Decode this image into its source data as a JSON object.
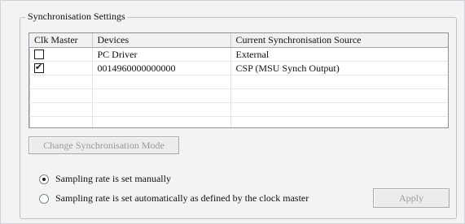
{
  "group": {
    "title": "Synchronisation Settings"
  },
  "table": {
    "columns": [
      "Clk Master",
      "Devices",
      "Current Synchronisation Source"
    ],
    "rows": [
      {
        "checked": false,
        "device": "PC Driver",
        "source": "External"
      },
      {
        "checked": true,
        "device": "0014960000000000",
        "source": "CSP (MSU Synch Output)"
      }
    ]
  },
  "buttons": {
    "change_mode": "Change Synchronisation Mode",
    "apply": "Apply"
  },
  "radios": [
    {
      "label": "Sampling rate is set manually",
      "selected": true
    },
    {
      "label": "Sampling rate is set automatically as defined by the clock master",
      "selected": false
    }
  ]
}
